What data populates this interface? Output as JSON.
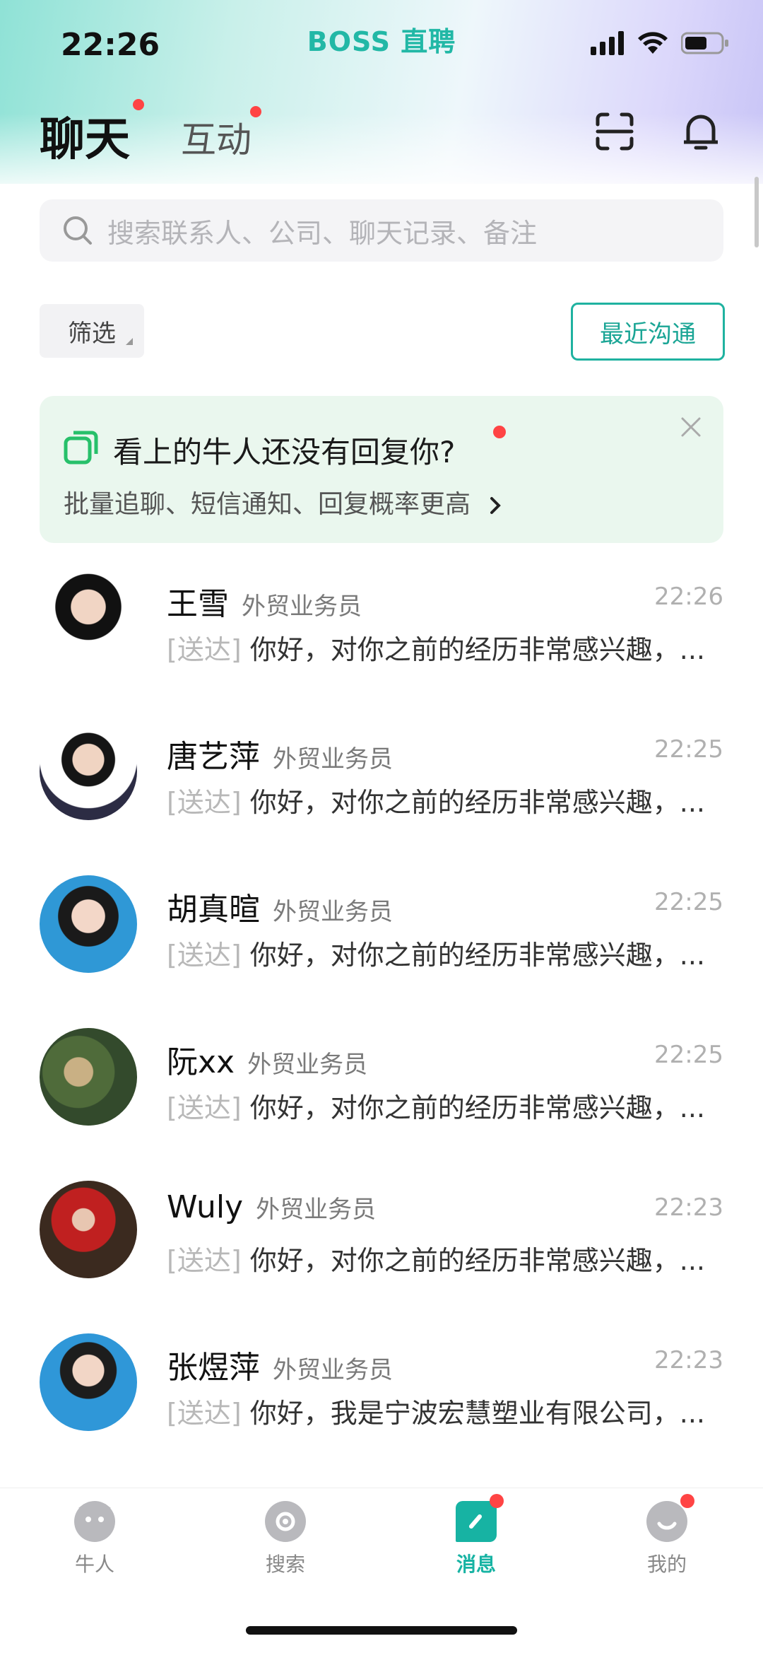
{
  "status_bar": {
    "time": "22:26",
    "brand": "BOSS 直聘"
  },
  "header": {
    "tab_chat": "聊天",
    "tab_interact": "互动"
  },
  "search": {
    "placeholder": "搜索联系人、公司、聊天记录、备注"
  },
  "filters": {
    "filter_label": "筛选",
    "recent_label": "最近沟通"
  },
  "banner": {
    "title": "看上的牛人还没有回复你?",
    "subtitle": "批量追聊、短信通知、回复概率更高"
  },
  "chats": [
    {
      "name": "王雪",
      "role": "外贸业务员",
      "time": "22:26",
      "tag": "[送达]",
      "message": "你好，对你之前的经历非常感兴趣，..."
    },
    {
      "name": "唐艺萍",
      "role": "外贸业务员",
      "time": "22:25",
      "tag": "[送达]",
      "message": "你好，对你之前的经历非常感兴趣，..."
    },
    {
      "name": "胡真暄",
      "role": "外贸业务员",
      "time": "22:25",
      "tag": "[送达]",
      "message": "你好，对你之前的经历非常感兴趣，..."
    },
    {
      "name": "阮xx",
      "role": "外贸业务员",
      "time": "22:25",
      "tag": "[送达]",
      "message": "你好，对你之前的经历非常感兴趣，..."
    },
    {
      "name": "Wuly",
      "role": "外贸业务员",
      "time": "22:23",
      "tag": "[送达]",
      "message": "你好，对你之前的经历非常感兴趣，..."
    },
    {
      "name": "张煜萍",
      "role": "外贸业务员",
      "time": "22:23",
      "tag": "[送达]",
      "message": "你好，我是宁波宏慧塑业有限公司，..."
    }
  ],
  "bottom_nav": [
    {
      "label": "牛人",
      "icon": "talent-icon",
      "active": false
    },
    {
      "label": "搜索",
      "icon": "search-nav-icon",
      "active": false
    },
    {
      "label": "消息",
      "icon": "message-icon",
      "active": true
    },
    {
      "label": "我的",
      "icon": "profile-icon",
      "active": false
    }
  ],
  "colors": {
    "accent": "#17b3a3",
    "badge": "#ff4444",
    "banner_bg": "#eaf7ee"
  }
}
